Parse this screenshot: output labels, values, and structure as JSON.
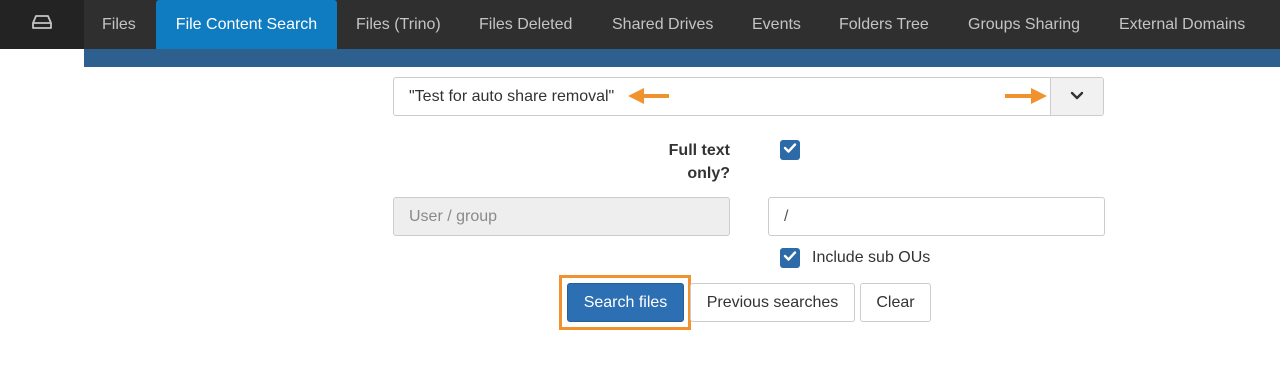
{
  "nav": {
    "tabs": [
      {
        "label": "Files"
      },
      {
        "label": "File Content Search"
      },
      {
        "label": "Files (Trino)"
      },
      {
        "label": "Files Deleted"
      },
      {
        "label": "Shared Drives"
      },
      {
        "label": "Events"
      },
      {
        "label": "Folders Tree"
      },
      {
        "label": "Groups Sharing"
      },
      {
        "label": "External Domains"
      }
    ],
    "active_tab": "File Content Search",
    "home_icon": "drive-icon"
  },
  "search": {
    "query": "\"Test for auto share removal\"",
    "dropdown_icon": "chevron-down-icon"
  },
  "options": {
    "full_text_label": "Full text only?",
    "full_text_checked": true,
    "user_group_placeholder": "User / group",
    "ou_path_value": "/",
    "include_sub_ous_label": "Include sub OUs",
    "include_sub_ous_checked": true
  },
  "actions": {
    "search_label": "Search files",
    "previous_label": "Previous searches",
    "clear_label": "Clear"
  },
  "colors": {
    "nav_bg": "#2f2f2f",
    "active_tab": "#0f7cc1",
    "subbar": "#2d5f8f",
    "primary": "#2c6fb3",
    "annotation": "#f0922e"
  }
}
